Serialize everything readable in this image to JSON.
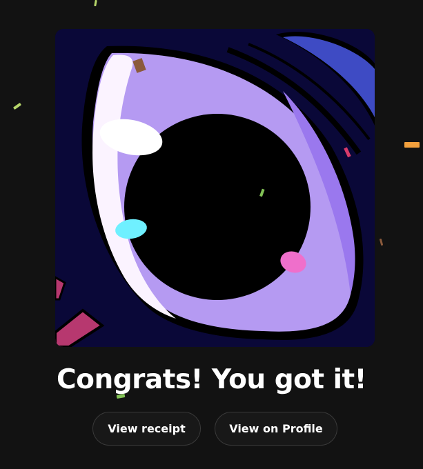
{
  "artwork": {
    "name": "NFT artwork - purple eye close-up",
    "colors": {
      "background": "#0a0838",
      "iris": "#b59af2",
      "iris_shadow": "#9a78ee",
      "pupil": "#000000",
      "sclera_highlight": "#fbf3ff",
      "blue_shape": "#3e4bc4",
      "magenta_shape": "#b7386f",
      "highlight_cyan": "#6ff0ff",
      "highlight_pink": "#ef6fcb"
    }
  },
  "message": {
    "title": "Congrats! You got it!"
  },
  "actions": {
    "receipt_label": "View receipt",
    "profile_label": "View on Profile"
  },
  "confetti_colors": [
    "#b6d66a",
    "#f2a03d",
    "#d83b6a",
    "#8b5a3c",
    "#82c256"
  ]
}
